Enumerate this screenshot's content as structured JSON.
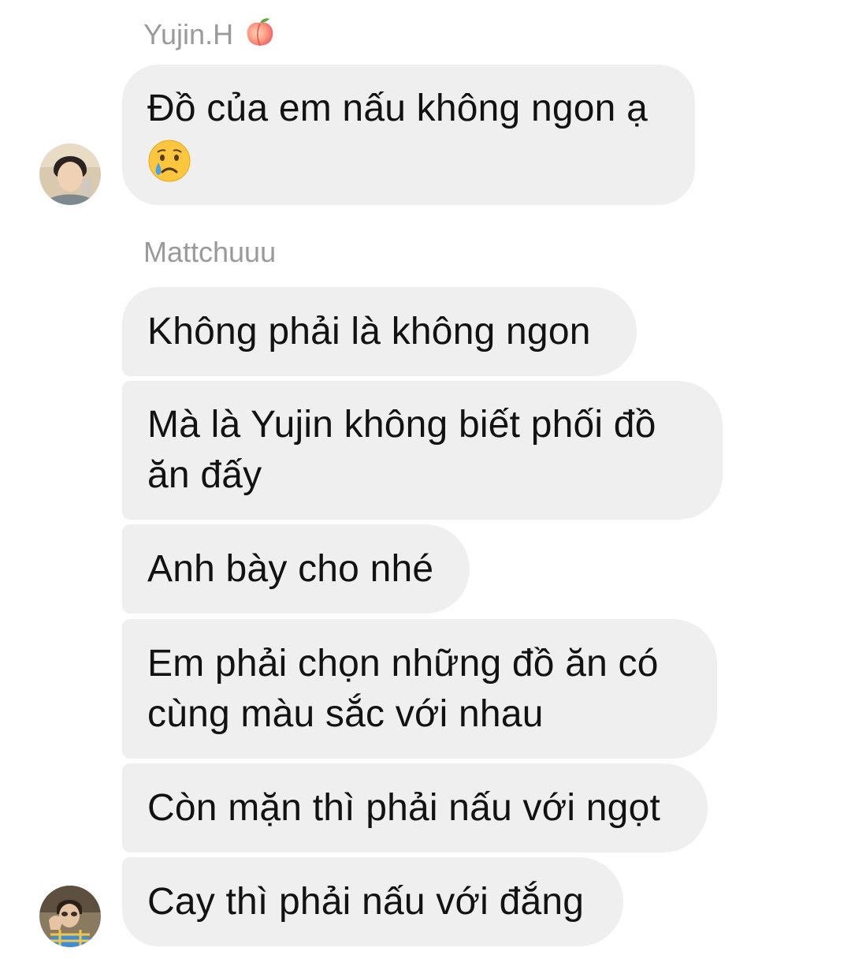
{
  "groups": [
    {
      "sender": "Yujin.H",
      "sender_emoji": "peach-icon",
      "messages": [
        {
          "text": "Đồ của em nấu không ngon ạ",
          "trailing_emoji": "crying-face-icon"
        }
      ]
    },
    {
      "sender": "Mattchuuu",
      "messages": [
        {
          "text": "Không phải là không ngon"
        },
        {
          "text": "Mà là Yujin không biết phối đồ\năn đấy"
        },
        {
          "text": "Anh bày cho nhé"
        },
        {
          "text": "Em phải chọn những đồ ăn có\ncùng màu sắc với nhau"
        },
        {
          "text": "Còn mặn thì phải nấu với ngọt"
        },
        {
          "text": "Cay thì phải nấu với đắng"
        }
      ]
    }
  ],
  "colors": {
    "bubble_bg": "#efefef",
    "sender_text": "#9a9a9a",
    "message_text": "#121212",
    "background": "#ffffff"
  }
}
